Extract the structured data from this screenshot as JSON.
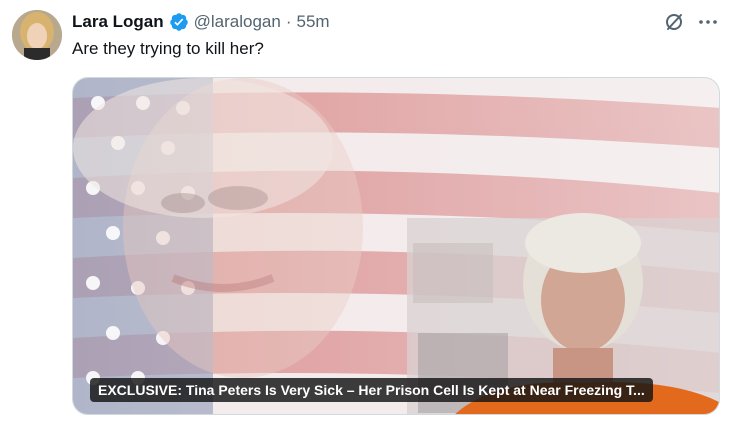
{
  "tweet": {
    "display_name": "Lara Logan",
    "handle": "@laralogan",
    "separator": "·",
    "time": "55m",
    "text": "Are they trying to kill her?",
    "verified_icon": "verified-badge-icon",
    "accent_color": "#1d9bf0"
  },
  "actions": {
    "grok_icon": "grok-icon",
    "more_icon": "more-dots-icon"
  },
  "media": {
    "caption": "EXCLUSIVE: Tina Peters Is Very Sick – Her Prison Cell Is Kept at Near Freezing T..."
  }
}
